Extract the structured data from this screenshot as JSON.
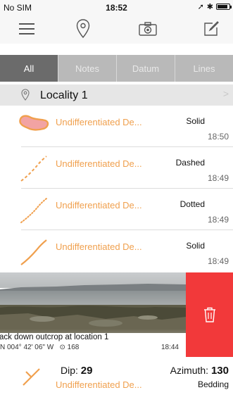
{
  "status": {
    "carrier": "No SIM",
    "time": "18:52"
  },
  "toolbar": {
    "menu_icon": "hamburger-icon",
    "location_icon": "location-pin-icon",
    "camera_icon": "camera-icon",
    "compose_icon": "compose-icon"
  },
  "tabs": [
    {
      "label": "All",
      "active": true
    },
    {
      "label": "Notes",
      "active": false
    },
    {
      "label": "Datum",
      "active": false
    },
    {
      "label": "Lines",
      "active": false
    }
  ],
  "section": {
    "title": "Locality 1"
  },
  "items": [
    {
      "name": "Undifferentiated De...",
      "type": "Solid",
      "time": "18:50",
      "icon": "polygon-icon"
    },
    {
      "name": "Undifferentiated De...",
      "type": "Dashed",
      "time": "18:49",
      "icon": "dashed-line-icon"
    },
    {
      "name": "Undifferentiated De...",
      "type": "Dotted",
      "time": "18:49",
      "icon": "dotted-line-icon"
    },
    {
      "name": "Undifferentiated De...",
      "type": "Solid",
      "time": "18:49",
      "icon": "solid-line-icon"
    }
  ],
  "photo": {
    "caption": "ack down outcrop at location 1",
    "coords": "N  004° 42' 06\" W",
    "altitude": "168",
    "time": "18:44",
    "delete_icon": "trash-icon"
  },
  "dip_item": {
    "dip_label": "Dip:",
    "dip_value": "29",
    "azimuth_label": "Azimuth:",
    "azimuth_value": "130",
    "name": "Undifferentiated De...",
    "type": "Bedding"
  },
  "colors": {
    "accent": "#f0a04e",
    "delete": "#f2393a",
    "active_tab": "#6b6b6b",
    "inactive_tab": "#b9b9b9"
  }
}
